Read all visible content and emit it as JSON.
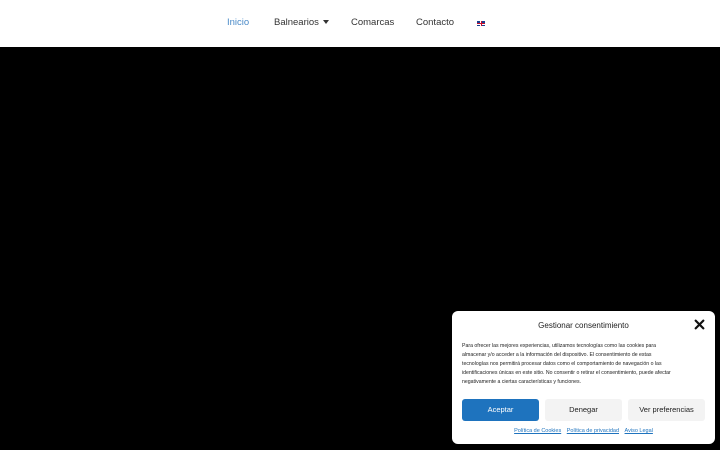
{
  "nav": {
    "items": [
      {
        "label": "Inicio"
      },
      {
        "label": "Balnearios"
      },
      {
        "label": "Comarcas"
      },
      {
        "label": "Contacto"
      }
    ],
    "language_icon": "uk-flag-icon"
  },
  "consent": {
    "title": "Gestionar consentimiento",
    "body_lines": [
      "Para ofrecer las mejores experiencias, utilizamos tecnologías como las cookies para",
      "almacenar y/o acceder a la información del dispositivo. El consentimiento de estas",
      "tecnologías nos permitirá procesar datos como el comportamiento de navegación o las",
      "identificaciones únicas en este sitio. No consentir o retirar el consentimiento, puede afectar",
      "negativamente a ciertas características y funciones."
    ],
    "accept_label": "Aceptar",
    "deny_label": "Denegar",
    "prefs_label": "Ver preferencias",
    "links": [
      "Política de Cookies",
      "Política de privacidad",
      "Aviso Legal"
    ],
    "accent_color": "#1e73be"
  }
}
